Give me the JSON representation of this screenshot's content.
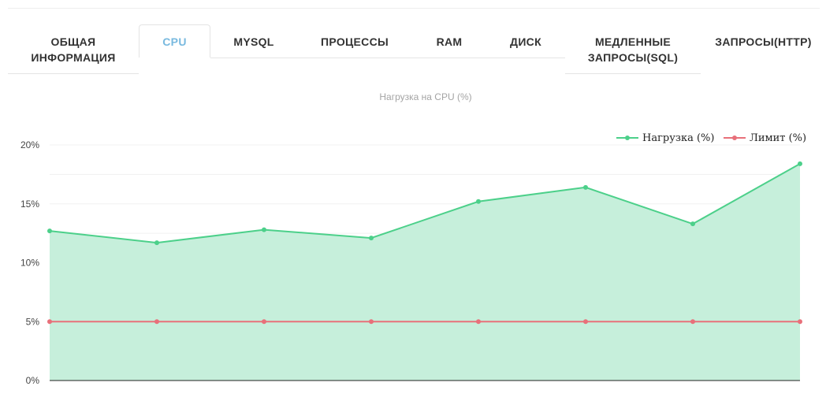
{
  "tabs": [
    {
      "label": "ОБЩАЯ\nИНФОРМАЦИЯ",
      "active": false
    },
    {
      "label": "CPU",
      "active": true
    },
    {
      "label": "MYSQL",
      "active": false
    },
    {
      "label": "ПРОЦЕССЫ",
      "active": false
    },
    {
      "label": "RAM",
      "active": false
    },
    {
      "label": "ДИСК",
      "active": false
    },
    {
      "label": "МЕДЛЕННЫЕ\nЗАПРОСЫ(SQL)",
      "active": false
    },
    {
      "label": "ЗАПРОСЫ(HTTP)",
      "active": false
    }
  ],
  "chart_data": {
    "type": "area",
    "title": "Нагрузка на CPU (%)",
    "xlabel": "",
    "ylabel": "",
    "x_labels_visible": false,
    "ylim": [
      0,
      20
    ],
    "yticks": [
      0,
      5,
      10,
      15,
      20
    ],
    "ytick_labels": [
      "0%",
      "5%",
      "10%",
      "15%",
      "20%"
    ],
    "grid": true,
    "legend_position": "top-right",
    "series": [
      {
        "name": "Нагрузка (%)",
        "values": [
          12.7,
          11.7,
          12.8,
          12.1,
          15.2,
          16.4,
          13.3,
          18.4
        ],
        "color": "#4cd08a",
        "fill": "#c6efdb"
      },
      {
        "name": "Лимит (%)",
        "values": [
          5,
          5,
          5,
          5,
          5,
          5,
          5,
          5
        ],
        "color": "#e8707a",
        "fill": "none"
      }
    ]
  }
}
